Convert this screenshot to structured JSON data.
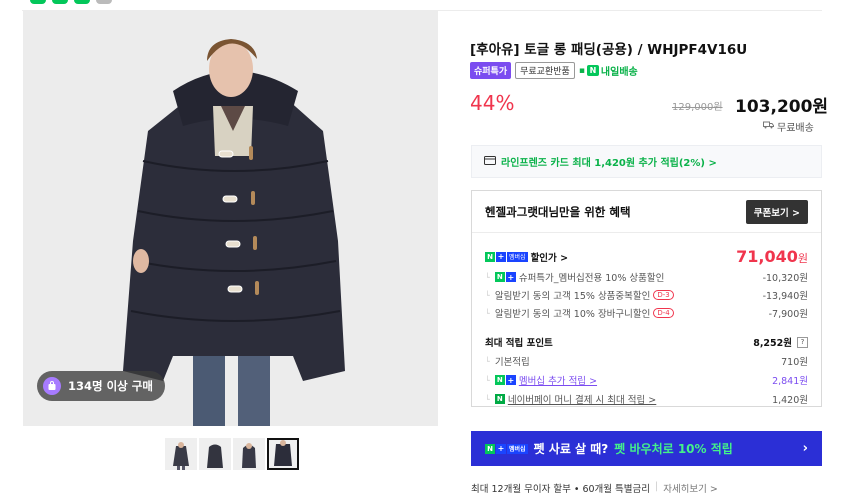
{
  "product": {
    "title": "[후아유] 토글 롱 패딩(공용) / WHJPF4V16U",
    "tags": {
      "super": "슈퍼특가",
      "free_return": "무료교환반품",
      "delivery": "내일배송"
    },
    "discount": "44%",
    "original_price": "129,000원",
    "price": "103,200원",
    "shipping": "무료배송",
    "card_benefit": "라인프렌즈 카드 최대 1,420원 추가 적립(2%) >",
    "buyers_badge": "134명 이상 구매"
  },
  "benefit": {
    "title": "헨젤과그랫대님만을 위한 혜택",
    "coupon_button": "쿠폰보기 >",
    "sale_label": "할인가 >",
    "sale_price": "71,040",
    "sale_unit": "원",
    "discounts": [
      {
        "label": "슈퍼특가_멤버십전용 10% 상품할인",
        "value": "-10,320원",
        "badge": ""
      },
      {
        "label": "알림받기 동의 고객 15% 상품중복할인",
        "value": "-13,940원",
        "badge": "D-3"
      },
      {
        "label": "알림받기 동의 고객 10% 장바구니할인",
        "value": "-7,900원",
        "badge": "D-4"
      }
    ],
    "points_label": "최대 적립 포인트",
    "points_value": "8,252원",
    "points_help": "?",
    "points": [
      {
        "label": "기본적립",
        "value": "710원"
      },
      {
        "label": "멤버십 추가 적립 >",
        "value": "2,841원"
      },
      {
        "label": "네이버페이 머니 결제 시 최대 적립 >",
        "value": "1,420원"
      }
    ]
  },
  "banner": {
    "membership": "멤버십",
    "text_a": "펫 사료 살 때?",
    "text_b": "펫 바우처로 10% 적립",
    "arrow": "›"
  },
  "installment": {
    "text": "최대 12개월 무이자 할부 • 60개월 특별금리",
    "more": "자세히보기 >"
  },
  "badges": {
    "n": "N",
    "plus": "+"
  },
  "colors": {
    "accent_red": "#f0354d",
    "naver_green": "#03c75a",
    "purple": "#7b4cf0",
    "banner_blue": "#2b2fd6"
  }
}
